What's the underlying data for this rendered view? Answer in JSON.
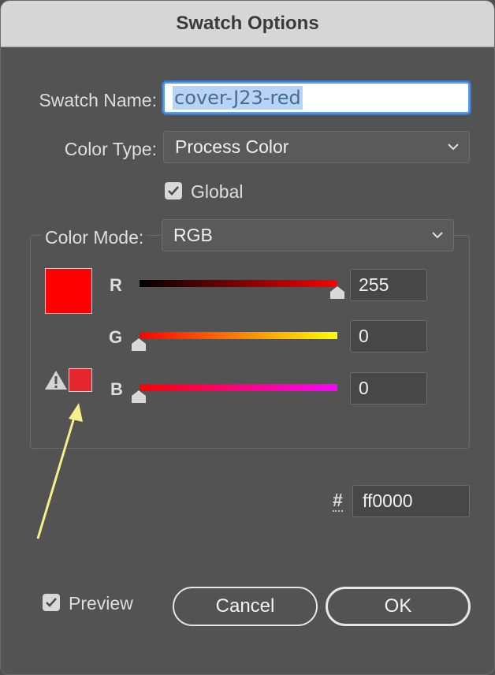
{
  "window": {
    "title": "Swatch Options"
  },
  "swatch_name": {
    "label": "Swatch Name:",
    "value": "cover-J23-red"
  },
  "color_type": {
    "label": "Color Type:",
    "selected": "Process Color"
  },
  "global": {
    "label": "Global",
    "checked": true
  },
  "color_mode": {
    "label": "Color Mode:",
    "selected": "RGB"
  },
  "sliders": {
    "r": {
      "label": "R",
      "value": "255",
      "fraction": 1.0
    },
    "g": {
      "label": "G",
      "value": "0",
      "fraction": 0.0
    },
    "b": {
      "label": "B",
      "value": "0",
      "fraction": 0.0
    }
  },
  "swatches": {
    "current_color": "#ff0000",
    "out_of_gamut_color": "#e5262d",
    "warning_icon": "warning-triangle-icon"
  },
  "hex": {
    "symbol": "#",
    "value": "ff0000"
  },
  "preview": {
    "label": "Preview",
    "checked": true
  },
  "buttons": {
    "cancel": "Cancel",
    "ok": "OK"
  },
  "annotation": {
    "arrow_color": "#f7f08a"
  }
}
